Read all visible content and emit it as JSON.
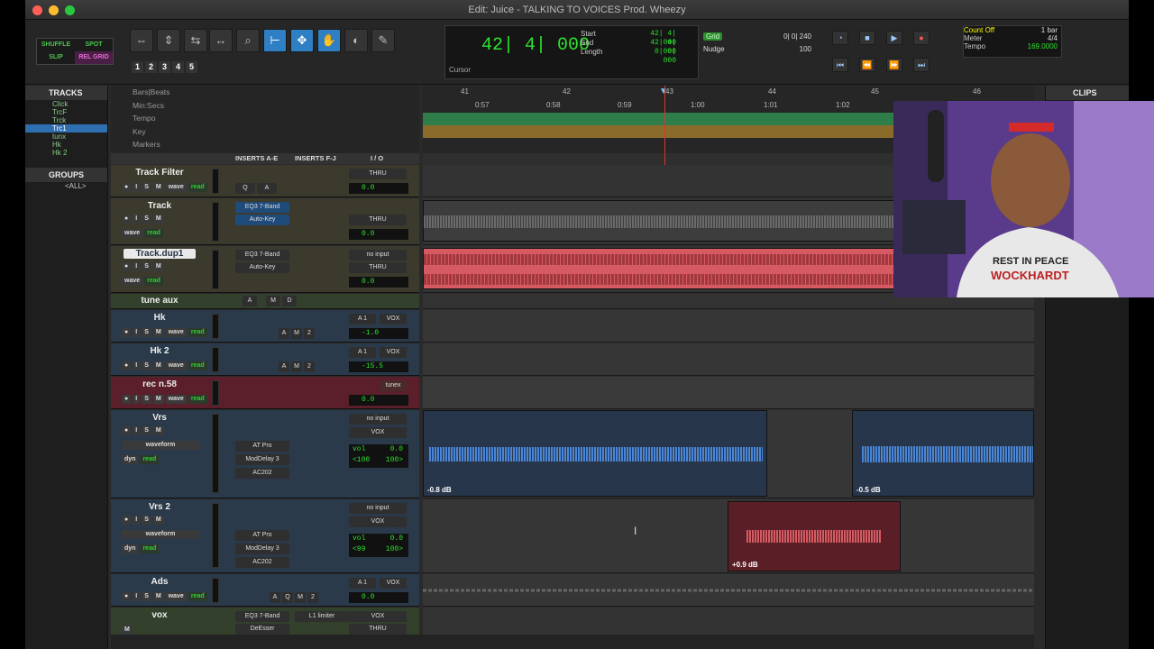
{
  "window": {
    "title": "Edit: Juice - TALKING TO VOICES Prod. Wheezy"
  },
  "modes": {
    "shuffle": "SHUFFLE",
    "spot": "SPOT",
    "slip": "SLIP",
    "rel_grid": "REL GRID"
  },
  "zoom_presets": [
    "1",
    "2",
    "3",
    "4",
    "5"
  ],
  "counter": {
    "main": "42| 4| 000",
    "cursor_label": "Cursor",
    "start_label": "Start",
    "start": "42| 4| 000",
    "end_label": "End",
    "end": "42| 4| 000",
    "length_label": "Length",
    "length": "0| 0| 000"
  },
  "grid": {
    "label": "Grid",
    "value": "0| 0| 240",
    "nudge_label": "Nudge",
    "nudge_value": "100"
  },
  "meter": {
    "count_off": "Count Off",
    "count_off_value": "1 bar",
    "meter_label": "Meter",
    "meter_value": "4/4",
    "tempo_label": "Tempo",
    "tempo_value": "169.0000"
  },
  "panels": {
    "tracks": "TRACKS",
    "groups": "GROUPS",
    "clips": "CLIPS",
    "all_group": "<ALL>"
  },
  "track_list": [
    "Click",
    "TrcF",
    "Trck",
    "Trc1",
    "tunx",
    "Hk",
    "Hk 2"
  ],
  "rulers": [
    "Bars|Beats",
    "Min:Secs",
    "Tempo",
    "Key",
    "Markers"
  ],
  "bars": [
    "41",
    "42",
    "43",
    "44",
    "45",
    "46"
  ],
  "times": [
    "0:57",
    "0:58",
    "0:59",
    "1:00",
    "1:01",
    "1:02"
  ],
  "column_headers": {
    "inserts_ae": "INSERTS A-E",
    "inserts_fj": "INSERTS F-J",
    "io": "I / O"
  },
  "tracks": [
    {
      "name": "Track Filter",
      "io": "THRU",
      "vol": "0.0",
      "ins1": "Q",
      "ins2": "A"
    },
    {
      "name": "Track",
      "ins1": "EQ3 7-Band",
      "ins2": "Auto-Key",
      "io": "THRU",
      "vol": "0.0"
    },
    {
      "name": "Track.dup1",
      "ins1": "EQ3 7-Band",
      "ins2": "Auto-Key",
      "io_in": "no input",
      "io": "THRU",
      "vol": "0.0"
    },
    {
      "name": "tune aux",
      "ins1": "A",
      "ins2": "M",
      "ins3": "D"
    },
    {
      "name": "Hk",
      "io_in": "A 1",
      "io": "VOX",
      "vol": "-1.0",
      "ins1": "A",
      "ins2": "M",
      "ins3": "2"
    },
    {
      "name": "Hk 2",
      "io_in": "A 1",
      "io": "VOX",
      "vol": "-15.5",
      "ins1": "A",
      "ins2": "M",
      "ins3": "2"
    },
    {
      "name": "rec n.58",
      "io": "tunex",
      "vol": "0.0"
    },
    {
      "name": "Vrs",
      "io_in": "no input",
      "io": "VOX",
      "ins1": "AT Pro",
      "ins2": "ModDelay 3",
      "ins3": "AC202",
      "vol_label": "vol",
      "vol": "0.0",
      "pan_l": "<100",
      "pan_r": "100>",
      "view": "waveform",
      "dyn": "dyn"
    },
    {
      "name": "Vrs 2",
      "io_in": "no input",
      "io": "VOX",
      "ins1": "AT Pro",
      "ins2": "ModDelay 3",
      "ins3": "AC202",
      "vol_label": "vol",
      "vol": "0.0",
      "pan_l": "<99",
      "pan_r": "100>",
      "view": "waveform",
      "dyn": "dyn"
    },
    {
      "name": "Ads",
      "io_in": "A 1",
      "io": "VOX",
      "vol": "0.0",
      "ins1": "A",
      "ins2": "Q",
      "ins3": "M",
      "ins4": "2"
    },
    {
      "name": "vox",
      "ins1": "EQ3 7-Band",
      "ins2": "DeEsser",
      "ins_fj": "L1 limiter",
      "io": "VOX",
      "io2": "THRU"
    }
  ],
  "track_buttons": {
    "rec": "●",
    "input": "I",
    "solo": "S",
    "mute": "M",
    "wave": "wave",
    "read": "read"
  },
  "clip_gains": {
    "vrs_a": "-0.8 dB",
    "vrs_b": "-0.5 dB",
    "vrs2": "+0.9 dB"
  },
  "webcam_text": {
    "shirt_line1": "REST IN PEACE",
    "shirt_line2": "WOCKHARDT"
  },
  "colors": {
    "green": "#2ee02e",
    "blue_clip": "#4a86d8",
    "red_clip": "#d65a62",
    "selection": "#2f7fc4"
  }
}
